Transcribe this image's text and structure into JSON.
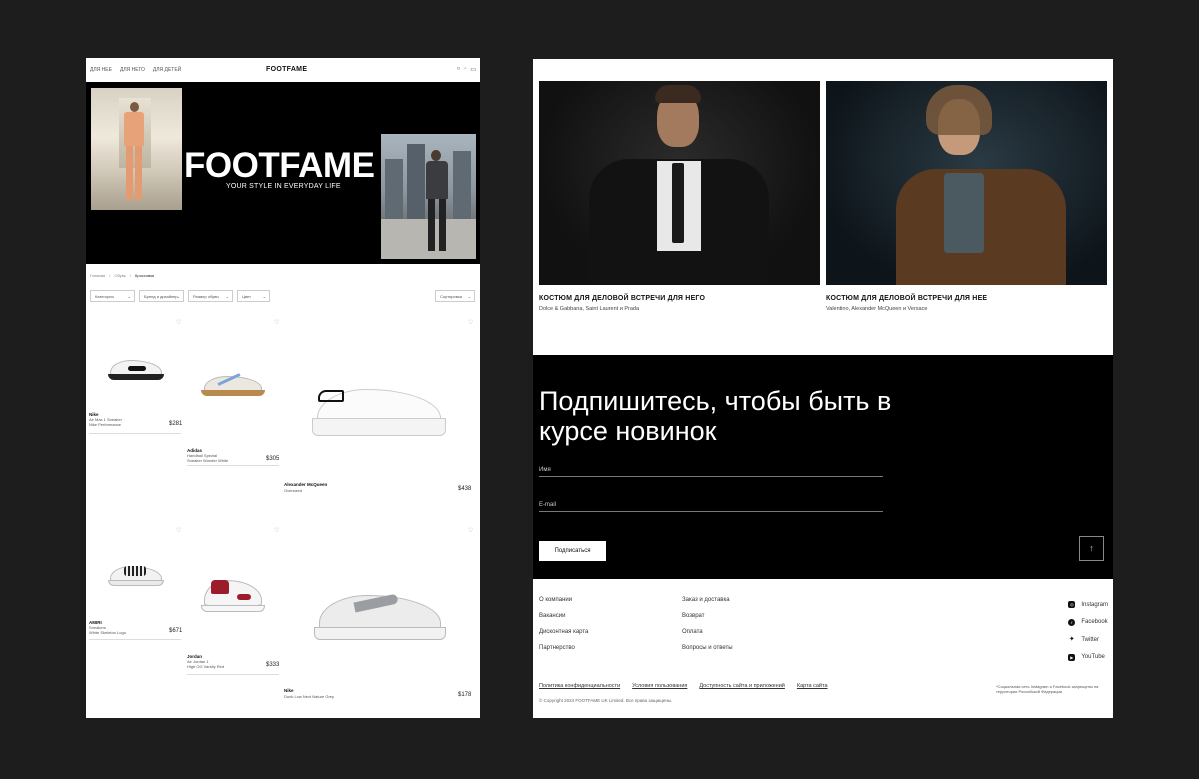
{
  "left_page": {
    "nav": {
      "links": [
        "ДЛЯ НЕЕ",
        "ДЛЯ НЕГО",
        "ДЛЯ ДЕТЕЙ"
      ],
      "logo": "FOOTFAME",
      "icons": [
        "search-icon",
        "user-icon",
        "cart-icon"
      ]
    },
    "hero": {
      "brand": "FOOTFAME",
      "tagline": "YOUR STYLE IN EVERYDAY LIFE"
    },
    "breadcrumbs": [
      "Главная",
      "Обувь",
      "Кроссовки"
    ],
    "filters": [
      "Категория",
      "Бренд и дизайнер",
      "Размер обуви",
      "Цвет"
    ],
    "sort": "Сортировка",
    "products": [
      {
        "brand": "Nike",
        "desc1": "Air Max 1 Sneaker",
        "desc2": "Nike Performance",
        "price": "$281"
      },
      {
        "brand": "Adidas",
        "desc1": "Handball Spezial",
        "desc2": "Sneaker Wonder White",
        "price": "$305"
      },
      {
        "brand": "Alexander McQueen",
        "desc1": "Oversized",
        "desc2": "",
        "price": "$438"
      },
      {
        "brand": "AMIRI",
        "desc1": "Sneakers",
        "desc2": "White Skeleton Logo",
        "price": "$671"
      },
      {
        "brand": "Jordan",
        "desc1": "Air Jordan 1",
        "desc2": "High OG Varsity Red",
        "price": "$333"
      },
      {
        "brand": "Nike",
        "desc1": "Dunk Low Next Nature Grey",
        "desc2": "",
        "price": "$178"
      }
    ]
  },
  "right_page": {
    "looks": [
      {
        "title": "КОСТЮМ ДЛЯ ДЕЛОВОЙ ВСТРЕЧИ ДЛЯ НЕГО",
        "brands": "Dolce & Gabbana, Saint Laurent и Prada"
      },
      {
        "title": "КОСТЮМ ДЛЯ ДЕЛОВОЙ ВСТРЕЧИ ДЛЯ НЕЕ",
        "brands": "Valentino, Alexander McQueen и Versace"
      }
    ],
    "subscribe": {
      "heading": "Подпишитесь, чтобы быть в курсе новинок",
      "name_placeholder": "Имя",
      "email_placeholder": "E-mail",
      "button": "Подписаться",
      "up_arrow": "↑"
    },
    "footer": {
      "col1": [
        "О компании",
        "Вакансии",
        "Дисконтная карта",
        "Партнерство"
      ],
      "col2": [
        "Заказ и доставка",
        "Возврат",
        "Оплата",
        "Вопросы и ответы"
      ],
      "social": [
        {
          "icon": "instagram-icon",
          "label": "Instagram"
        },
        {
          "icon": "facebook-icon",
          "label": "Facebook"
        },
        {
          "icon": "twitter-icon",
          "label": "Twitter"
        },
        {
          "icon": "youtube-icon",
          "label": "YouTube"
        }
      ],
      "links": [
        "Политика конфиденциальности",
        "Условия пользования",
        "Доступность сайта и приложений",
        "Карта сайта"
      ],
      "copyright": "© Copyright 2024 FOOTFAME UK Limited. Все права защищены.",
      "note": "*Социальная сеть Instagram и Facebook запрещены на территории Российской Федерации"
    }
  },
  "colors": {
    "page_bg": "#1d1d1d",
    "hero_bg": "#000000",
    "subscribe_bg": "#000000",
    "card_bg": "#ffffff"
  }
}
